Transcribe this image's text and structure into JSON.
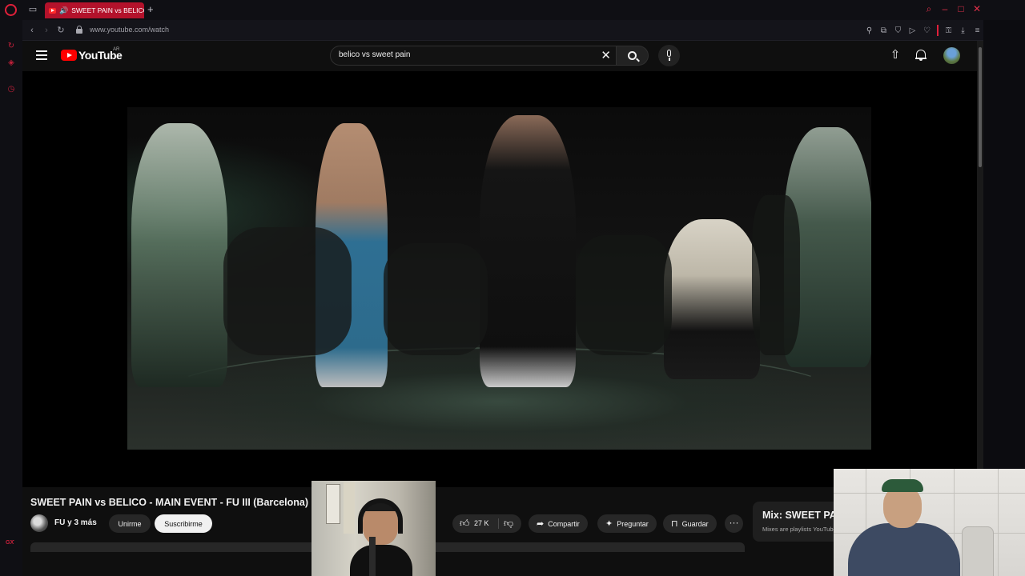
{
  "browser": {
    "tab_title": "SWEET PAIN vs BELICO",
    "url": "www.youtube.com/watch",
    "sidebar_label": "GX",
    "accent": "#e0203a"
  },
  "masthead": {
    "logo_text": "YouTube",
    "region": "AR",
    "search_value": "belico vs sweet pain",
    "icons": [
      "menu-icon",
      "search-icon",
      "mic-icon",
      "upload-icon",
      "bell-icon",
      "avatar"
    ]
  },
  "video": {
    "title": "SWEET PAIN vs BELICO - MAIN EVENT - FU III (Barcelona)",
    "channel": "FU y 3 más",
    "join_label": "Unirme",
    "subscribe_label": "Suscribirme",
    "likes": "27 K",
    "share_label": "Compartir",
    "ask_label": "Preguntar",
    "save_label": "Guardar"
  },
  "mix": {
    "title": "Mix: SWEET PAIN vs BELICO",
    "subtitle": "Mixes are playlists YouTube makes for you"
  }
}
